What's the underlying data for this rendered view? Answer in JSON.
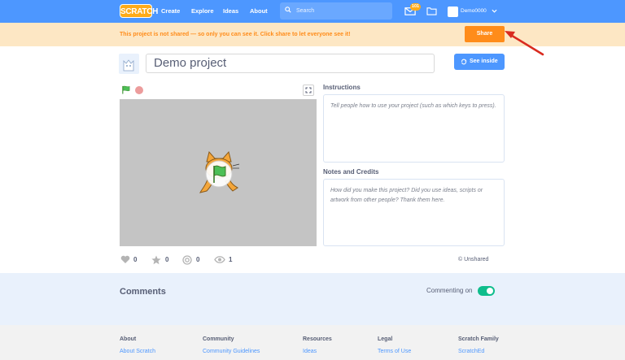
{
  "nav": {
    "logo": "SCRATCH",
    "links": [
      "Create",
      "Explore",
      "Ideas",
      "About"
    ],
    "search_placeholder": "Search",
    "message_count": "101",
    "username": "Demo0000"
  },
  "banner": {
    "text": "This project is not shared — so only you can see it. Click share to let everyone see it!",
    "share_label": "Share"
  },
  "project": {
    "title": "Demo project",
    "see_inside_label": "See inside"
  },
  "stats": {
    "loves": "0",
    "favorites": "0",
    "remixes": "0",
    "views": "1",
    "share_status": "© Unshared"
  },
  "instructions": {
    "heading": "Instructions",
    "placeholder": "Tell people how to use your project (such as which keys to press)."
  },
  "notes": {
    "heading": "Notes and Credits",
    "placeholder": "How did you make this project? Did you use ideas, scripts or artwork from other people? Thank them here."
  },
  "comments": {
    "heading": "Comments",
    "commenting_label": "Commenting on"
  },
  "footer": {
    "columns": [
      {
        "heading": "About",
        "first_link": "About Scratch"
      },
      {
        "heading": "Community",
        "first_link": "Community Guidelines"
      },
      {
        "heading": "Resources",
        "first_link": "Ideas"
      },
      {
        "heading": "Legal",
        "first_link": "Terms of Use"
      },
      {
        "heading": "Scratch Family",
        "first_link": "ScratchEd"
      }
    ]
  },
  "colors": {
    "nav_blue": "#4d97ff",
    "banner_bg": "#fde7c4",
    "share_orange": "#ff8c1a",
    "toggle_green": "#0fbd8c",
    "arrow_red": "#d92b1f"
  }
}
